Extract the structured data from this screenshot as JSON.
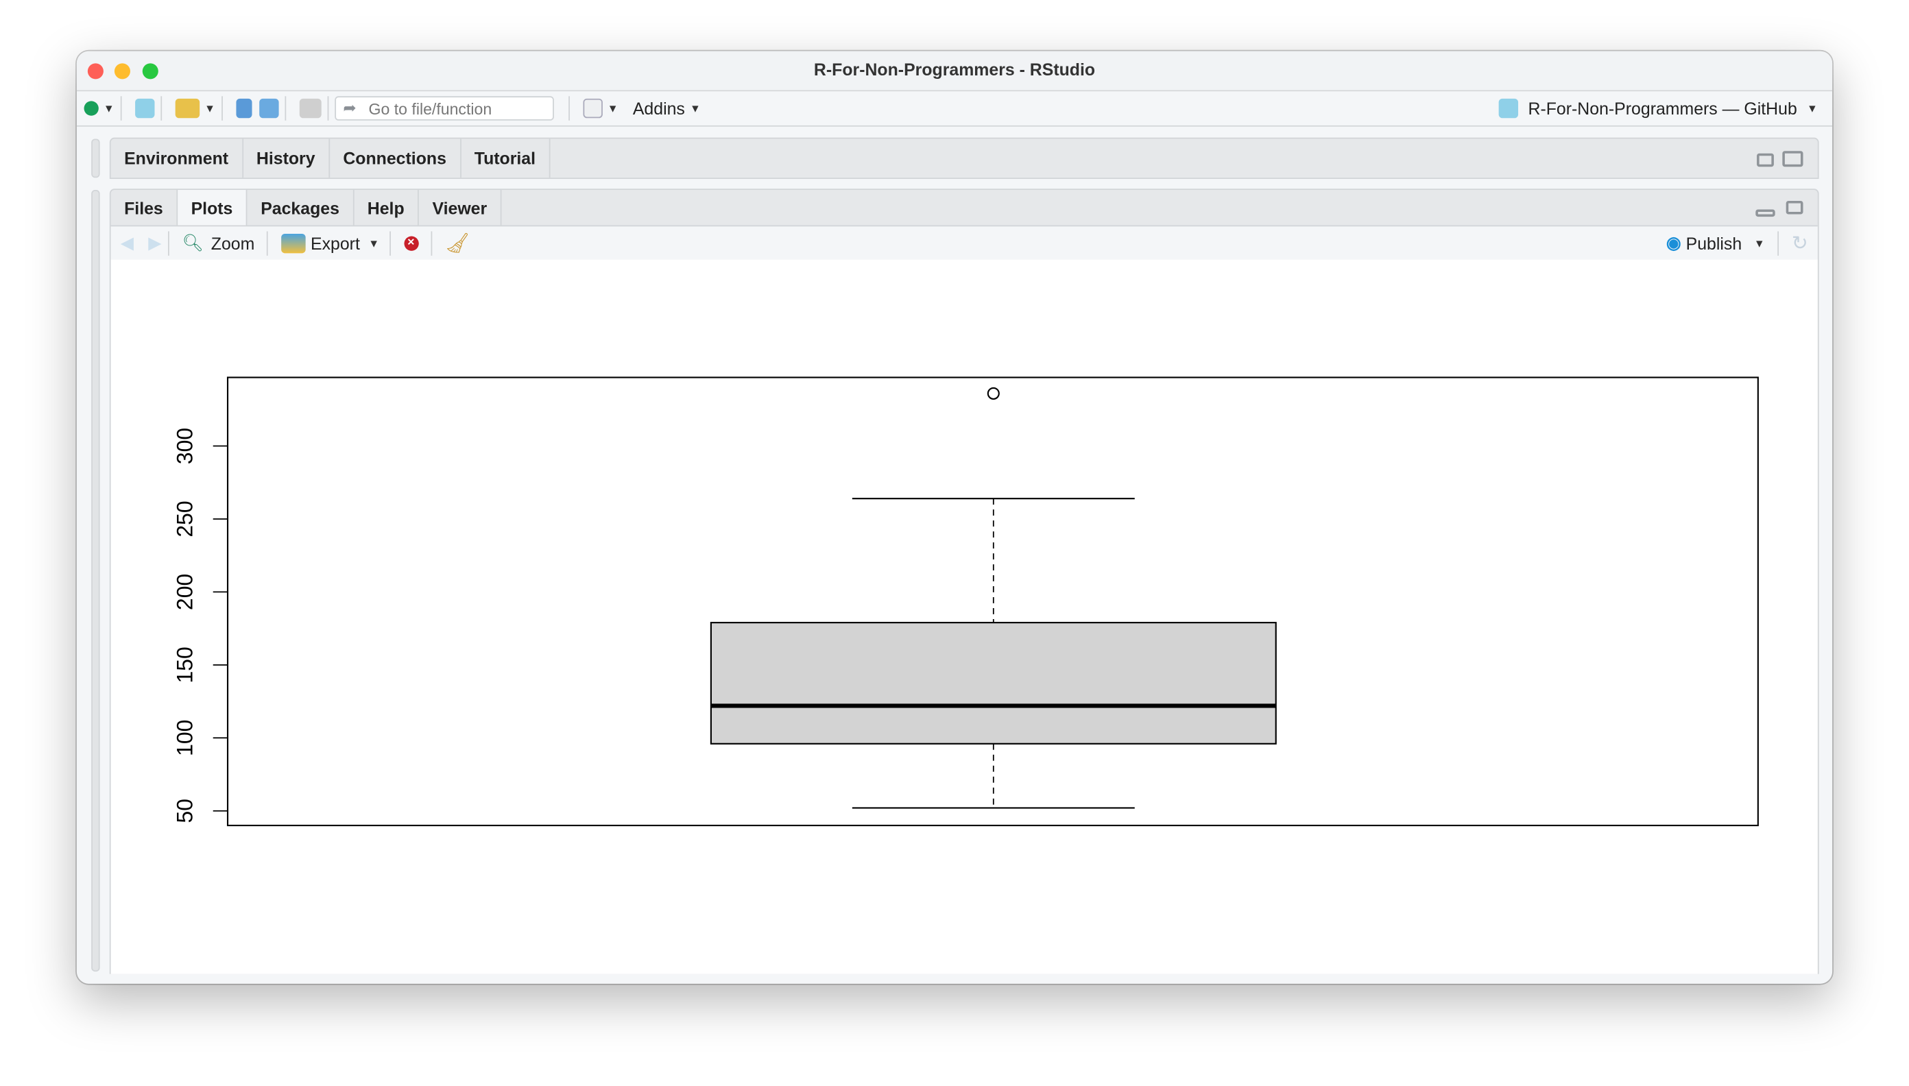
{
  "window": {
    "title": "R-For-Non-Programmers - RStudio"
  },
  "toolbar": {
    "goto_placeholder": "Go to file/function",
    "addins": "Addins",
    "project": "R-For-Non-Programmers — GitHub"
  },
  "top_pane": {
    "tabs": [
      "Environment",
      "History",
      "Connections",
      "Tutorial"
    ]
  },
  "bottom_pane": {
    "tabs": [
      "Files",
      "Plots",
      "Packages",
      "Help",
      "Viewer"
    ],
    "active_tab": "Plots",
    "zoom": "Zoom",
    "export": "Export",
    "publish": "Publish"
  },
  "colors": {
    "box_fill": "#d3d3d3",
    "publish_blue": "#1a8fd8"
  },
  "chart_data": {
    "type": "boxplot",
    "title": "",
    "xlabel": "",
    "ylabel": "",
    "ylim": [
      40,
      347
    ],
    "yticks": [
      50,
      100,
      150,
      200,
      250,
      300
    ],
    "box": {
      "lower_whisker": 52,
      "q1": 96,
      "median": 122,
      "q3": 179,
      "upper_whisker": 264,
      "outliers": [
        336
      ]
    }
  }
}
